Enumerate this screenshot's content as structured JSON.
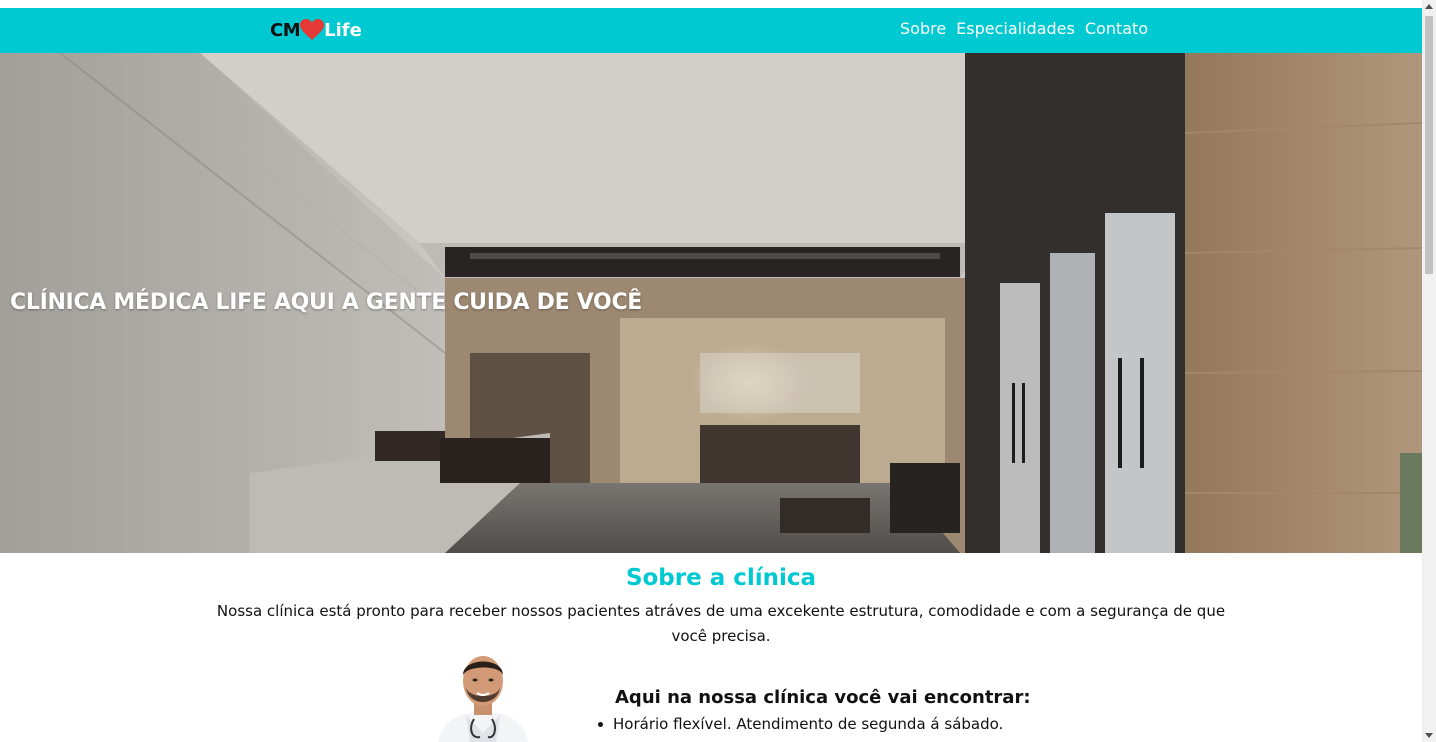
{
  "nav": {
    "logo_cm": "CM",
    "logo_life": "Life",
    "links": [
      "Sobre",
      "Especialidades",
      "Contato"
    ]
  },
  "hero": {
    "title": "CLÍNICA MÉDICA LIFE AQUI A GENTE CUIDA DE VOCÊ"
  },
  "about": {
    "title": "Sobre a clínica",
    "description": "Nossa clínica está pronto para receber nossos pacientes atráves de uma excekente estrutura, comodidade e com a segurança de que você precisa.",
    "features_title": "Aqui na nossa clínica você vai encontrar:",
    "features": [
      "Horário flexível. Atendimento de segunda á sábado."
    ]
  },
  "colors": {
    "accent": "#00c9d2",
    "heart": "#e53935"
  },
  "icons": [
    "heart-icon"
  ]
}
